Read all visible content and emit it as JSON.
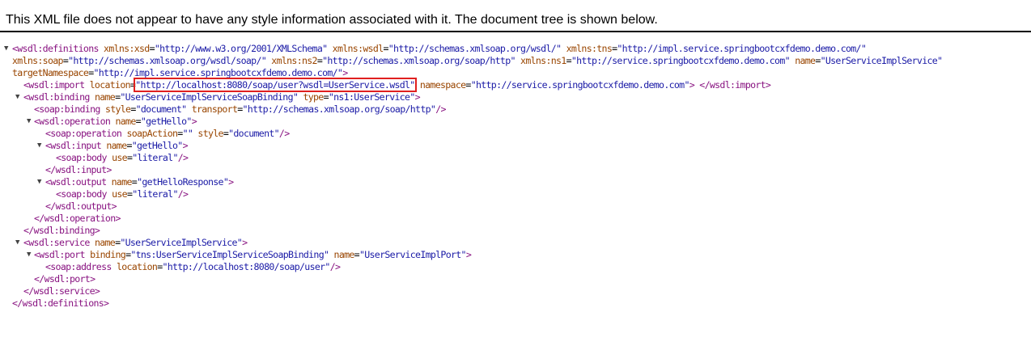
{
  "header": {
    "message": "This XML file does not appear to have any style information associated with it. The document tree is shown below."
  },
  "xml": {
    "definitions": {
      "tag": "wsdl:definitions",
      "attrs": [
        {
          "name": "xmlns:xsd",
          "value": "\"http://www.w3.org/2001/XMLSchema\""
        },
        {
          "name": "xmlns:wsdl",
          "value": "\"http://schemas.xmlsoap.org/wsdl/\""
        },
        {
          "name": "xmlns:tns",
          "value": "\"http://impl.service.springbootcxfdemo.demo.com/\""
        },
        {
          "name": "xmlns:soap",
          "value": "\"http://schemas.xmlsoap.org/wsdl/soap/\""
        },
        {
          "name": "xmlns:ns2",
          "value": "\"http://schemas.xmlsoap.org/soap/http\""
        },
        {
          "name": "xmlns:ns1",
          "value": "\"http://service.springbootcxfdemo.demo.com\""
        },
        {
          "name": "name",
          "value": "\"UserServiceImplService\""
        },
        {
          "name": "targetNamespace",
          "value": "\"http://impl.service.springbootcxfdemo.demo.com/\""
        }
      ],
      "close": "</wsdl:definitions>"
    },
    "import": {
      "tag": "wsdl:import",
      "location_attr": "location",
      "location_value": "\"http://localhost:8080/soap/user?wsdl=UserService.wsdl\"",
      "namespace_attr": "namespace",
      "namespace_value": "\"http://service.springbootcxfdemo.demo.com\"",
      "close": "</wsdl:import>"
    },
    "binding": {
      "tag": "wsdl:binding",
      "name_attr": "name",
      "name_value": "\"UserServiceImplServiceSoapBinding\"",
      "type_attr": "type",
      "type_value": "\"ns1:UserService\"",
      "close": "</wsdl:binding>",
      "soap_binding": {
        "tag": "soap:binding",
        "style_attr": "style",
        "style_value": "\"document\"",
        "transport_attr": "transport",
        "transport_value": "\"http://schemas.xmlsoap.org/soap/http\""
      },
      "operation": {
        "tag": "wsdl:operation",
        "name_attr": "name",
        "name_value": "\"getHello\"",
        "close": "</wsdl:operation>",
        "soap_operation": {
          "tag": "soap:operation",
          "action_attr": "soapAction",
          "action_value": "\"\"",
          "style_attr": "style",
          "style_value": "\"document\""
        },
        "input": {
          "tag": "wsdl:input",
          "name_attr": "name",
          "name_value": "\"getHello\"",
          "close": "</wsdl:input>",
          "body_tag": "soap:body",
          "use_attr": "use",
          "use_value": "\"literal\""
        },
        "output": {
          "tag": "wsdl:output",
          "name_attr": "name",
          "name_value": "\"getHelloResponse\"",
          "close": "</wsdl:output>",
          "body_tag": "soap:body",
          "use_attr": "use",
          "use_value": "\"literal\""
        }
      }
    },
    "service": {
      "tag": "wsdl:service",
      "name_attr": "name",
      "name_value": "\"UserServiceImplService\"",
      "close": "</wsdl:service>",
      "port": {
        "tag": "wsdl:port",
        "binding_attr": "binding",
        "binding_value": "\"tns:UserServiceImplServiceSoapBinding\"",
        "name_attr": "name",
        "name_value": "\"UserServiceImplPort\"",
        "close": "</wsdl:port>",
        "address_tag": "soap:address",
        "location_attr": "location",
        "location_value": "\"http://localhost:8080/soap/user\""
      }
    }
  },
  "colors": {
    "tag": "#881280",
    "attr": "#994500",
    "value": "#1a1aa6",
    "highlight": "#e02020"
  }
}
